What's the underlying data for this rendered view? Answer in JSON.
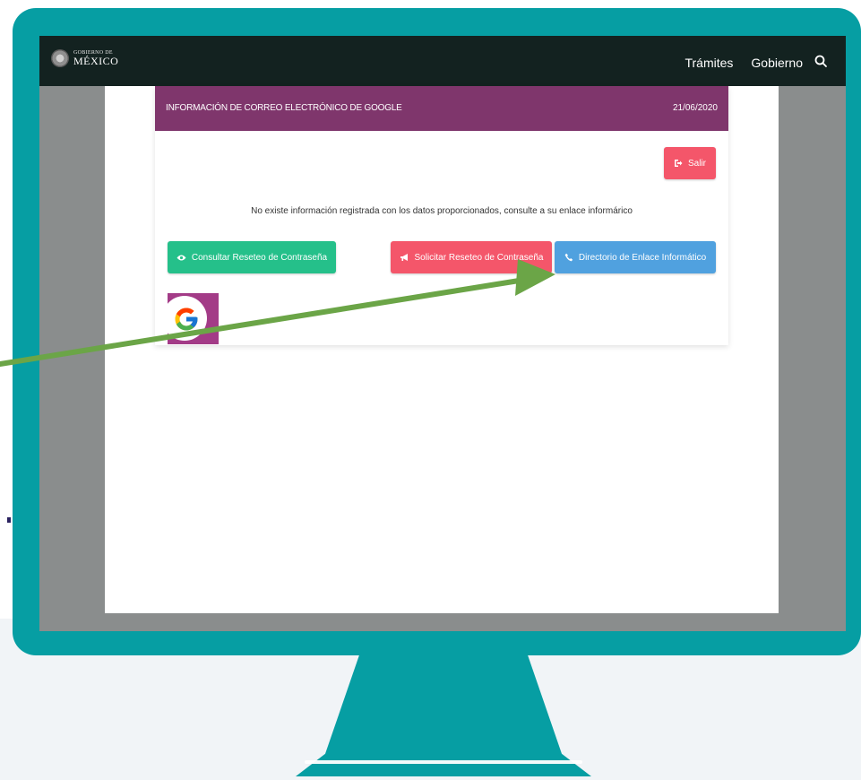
{
  "navbar": {
    "brand_top": "GOBIERNO DE",
    "brand_main": "MÉXICO",
    "links": [
      "Trámites",
      "Gobierno"
    ]
  },
  "card": {
    "title": "INFORMACIÓN DE CORREO ELECTRÓNICO DE GOOGLE",
    "date": "21/06/2020",
    "exit_label": "Salir",
    "message": "No existe información registrada con los datos proporcionados, consulte a su enlace informárico",
    "consult_label": "Consultar Reseteo de Contraseña",
    "request_label": "Solicitar Reseteo de Contraseña",
    "directory_label": "Directorio de Enlace Informático"
  },
  "colors": {
    "frame": "#069ea3",
    "header": "#7f366c",
    "green": "#25c08a",
    "red": "#f4566a",
    "blue": "#50a1df",
    "arrow": "#6ba547"
  },
  "icons": [
    "search-icon",
    "sign-out-icon",
    "eye-icon",
    "megaphone-icon",
    "phone-icon",
    "google-logo"
  ]
}
